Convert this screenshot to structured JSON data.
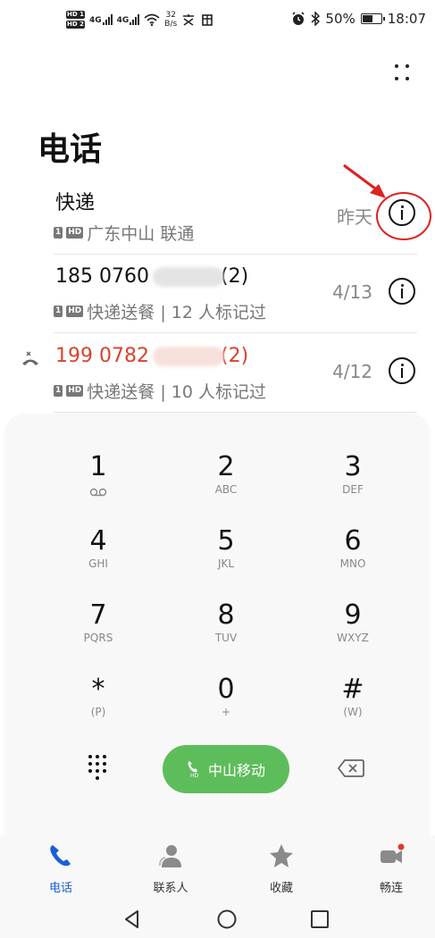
{
  "status_bar": {
    "sim1": "HD 1",
    "sim2": "HD 2",
    "net1": "4G",
    "net2": "4G",
    "speed_value": "32",
    "speed_unit": "B/s",
    "battery": "50%",
    "time": "18:07"
  },
  "header": {
    "title": "电话"
  },
  "calls": [
    {
      "name": "快递",
      "sim": "1",
      "hd": "HD",
      "detail": "广东中山 联通",
      "time": "昨天",
      "missed": false
    },
    {
      "name_start": "185 0760",
      "name_end": "(2)",
      "sim": "1",
      "hd": "HD",
      "detail": "快递送餐 | 12 人标记过",
      "time": "4/13",
      "missed": false
    },
    {
      "name_start": "199 0782",
      "name_end": "(2)",
      "sim": "1",
      "hd": "HD",
      "detail": "快递送餐 | 10 人标记过",
      "time": "4/12",
      "missed": true
    }
  ],
  "dialpad": {
    "keys": [
      {
        "digit": "1",
        "letters": ""
      },
      {
        "digit": "2",
        "letters": "ABC"
      },
      {
        "digit": "3",
        "letters": "DEF"
      },
      {
        "digit": "4",
        "letters": "GHI"
      },
      {
        "digit": "5",
        "letters": "JKL"
      },
      {
        "digit": "6",
        "letters": "MNO"
      },
      {
        "digit": "7",
        "letters": "PQRS"
      },
      {
        "digit": "8",
        "letters": "TUV"
      },
      {
        "digit": "9",
        "letters": "WXYZ"
      },
      {
        "digit": "*",
        "letters": "(P)"
      },
      {
        "digit": "0",
        "letters": "+"
      },
      {
        "digit": "#",
        "letters": "(W)"
      }
    ],
    "call_button_label": "中山移动",
    "call_button_color": "#5ebd5b"
  },
  "tabs": [
    {
      "label": "电话",
      "icon": "phone-icon",
      "active": true
    },
    {
      "label": "联系人",
      "icon": "contacts-icon",
      "active": false
    },
    {
      "label": "收藏",
      "icon": "star-icon",
      "active": false
    },
    {
      "label": "畅连",
      "icon": "video-call-icon",
      "active": false
    }
  ],
  "colors": {
    "accent": "#1a5fd6",
    "missed": "#d9432c",
    "annotation": "#e02020"
  }
}
